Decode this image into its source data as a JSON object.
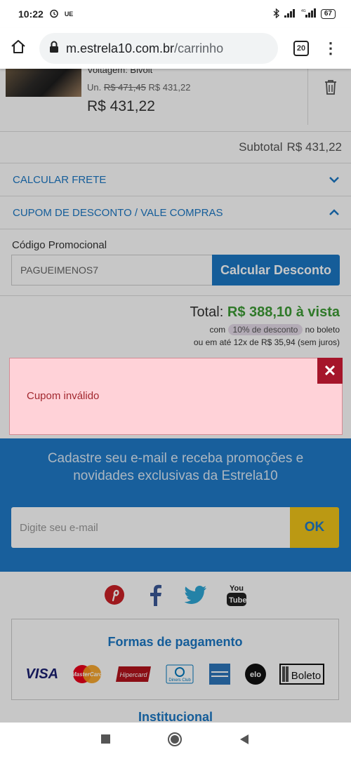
{
  "status": {
    "time": "10:22",
    "ue": "UE",
    "battery": "67"
  },
  "browser": {
    "host": "m.estrela10.com.br",
    "path": "/carrinho",
    "tabs_count": "20"
  },
  "product": {
    "variant": "Voltagem: Bivolt",
    "unit_prefix": "Un.",
    "old_price": "R$ 471,45",
    "unit_price": "R$ 431,22",
    "price": "R$ 431,22"
  },
  "subtotal": {
    "label": "Subtotal",
    "value": "R$ 431,22"
  },
  "accordions": {
    "frete": "CALCULAR FRETE",
    "cupom": "CUPOM DE DESCONTO / VALE COMPRAS"
  },
  "promo": {
    "label": "Código Promocional",
    "value": "PAGUEIMENOS7",
    "button": "Calcular Desconto"
  },
  "total": {
    "label": "Total:",
    "amount": "R$ 388,10",
    "vista": "à vista",
    "boleto_prefix": "com",
    "discount": "10% de desconto",
    "boleto_suffix": "no boleto",
    "installments": "ou em até 12x de R$ 35,94 (sem juros)"
  },
  "alert": {
    "message": "Cupom inválido",
    "close": "✕"
  },
  "newsletter": {
    "text": "Cadastre seu e-mail e receba promoções e novidades exclusivas da Estrela10",
    "placeholder": "Digite seu e-mail",
    "button": "OK"
  },
  "payments": {
    "title": "Formas de pagamento",
    "visa": "VISA",
    "mastercard": "MasterCard",
    "hipercard": "Hipercard",
    "diners": "Diners Club",
    "elo": "elo",
    "boleto": "Boleto"
  },
  "institucional": "Institucional",
  "colors": {
    "accent": "#1b78c5",
    "green": "#3d9b35",
    "alert_bg": "#ffd2d8",
    "alert_close": "#a5152a",
    "ok_yellow": "#f0c419"
  }
}
